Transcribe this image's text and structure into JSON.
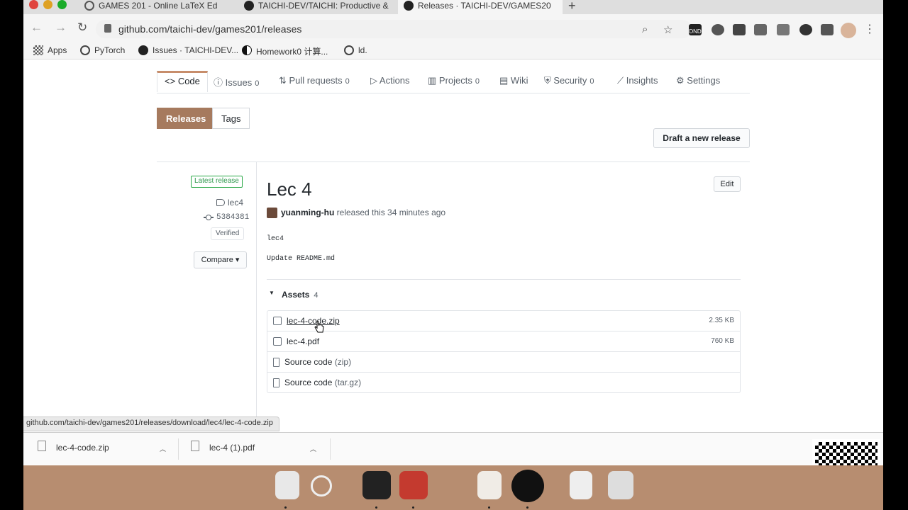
{
  "browser": {
    "tabs": [
      {
        "title": "GAMES 201 - Online LaTeX Ed",
        "active": false
      },
      {
        "title": "TAICHI-DEV/TAICHI: Productive &",
        "active": false
      },
      {
        "title": "Releases · TAICHI-DEV/GAMES20",
        "active": true
      }
    ],
    "new_tab_label": "+",
    "url": "github.com/taichi-dev/games201/releases",
    "badge_dnd": "DND",
    "bookmarks": [
      {
        "label": "Apps",
        "icon": "apps-grid-icon"
      },
      {
        "label": "PyTorch",
        "icon": "pytorch-icon"
      },
      {
        "label": "Issues · TAICHI-DEV...",
        "icon": "github-icon"
      },
      {
        "label": "Homework0 计算...",
        "icon": "taichi-icon"
      },
      {
        "label": "ld.",
        "icon": "globe-icon"
      }
    ]
  },
  "repo_nav": {
    "tabs": [
      {
        "label": "Code",
        "icon": "code-icon",
        "count": ""
      },
      {
        "label": "Issues",
        "icon": "issue-icon",
        "count": "0"
      },
      {
        "label": "Pull requests",
        "icon": "pull-request-icon",
        "count": "0"
      },
      {
        "label": "Actions",
        "icon": "play-icon",
        "count": ""
      },
      {
        "label": "Projects",
        "icon": "project-icon",
        "count": "0"
      },
      {
        "label": "Wiki",
        "icon": "book-icon",
        "count": ""
      },
      {
        "label": "Security",
        "icon": "shield-icon",
        "count": "0"
      },
      {
        "label": "Insights",
        "icon": "graph-icon",
        "count": ""
      },
      {
        "label": "Settings",
        "icon": "gear-icon",
        "count": ""
      }
    ],
    "code_prefix": "<>"
  },
  "subnav": {
    "releases": "Releases",
    "tags": "Tags"
  },
  "draft_button": "Draft a new release",
  "release": {
    "latest_badge": "Latest release",
    "tag": "lec4",
    "commit": "5384381",
    "verified": "Verified",
    "compare": "Compare ▾",
    "title": "Lec 4",
    "edit": "Edit",
    "author": "yuanming-hu",
    "released_text": " released this 34 minutes ago",
    "body_line1": "lec4",
    "body_line2": "Update README.md",
    "assets_label": "Assets",
    "assets_count": "4",
    "assets": [
      {
        "name": "lec-4-code.zip",
        "size": "2.35 KB",
        "type": "package"
      },
      {
        "name": "lec-4.pdf",
        "size": "760 KB",
        "type": "package"
      },
      {
        "name": "Source code",
        "suffix": "(zip)",
        "size": "",
        "type": "source"
      },
      {
        "name": "Source code",
        "suffix": "(tar.gz)",
        "size": "",
        "type": "source"
      }
    ]
  },
  "status_url": "github.com/taichi-dev/games201/releases/download/lec4/lec-4-code.zip",
  "downloads": [
    {
      "name": "lec-4-code.zip"
    },
    {
      "name": "lec-4 (1).pdf"
    }
  ],
  "colors": {
    "accent_tab": "#c78d6b",
    "releases_btn": "#a67a5e",
    "dock": "#b78d70",
    "verified_green": "#2c974b"
  }
}
